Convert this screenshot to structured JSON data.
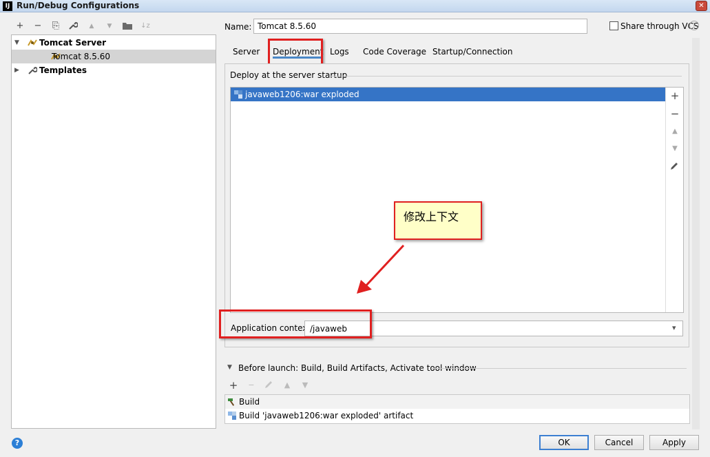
{
  "window": {
    "title": "Run/Debug Configurations",
    "icon_text": "IJ",
    "close_symbol": "✕"
  },
  "toolbar": {
    "icons": [
      {
        "name": "add-icon",
        "glyph": "+"
      },
      {
        "name": "remove-icon",
        "glyph": "−"
      },
      {
        "name": "copy-icon",
        "glyph": "⎘"
      },
      {
        "name": "wrench-icon",
        "glyph": "🔧"
      },
      {
        "name": "move-up-icon",
        "glyph": "▲"
      },
      {
        "name": "move-down-icon",
        "glyph": "▼"
      },
      {
        "name": "new-folder-icon",
        "glyph": "▰"
      },
      {
        "name": "sort-icon",
        "glyph": "↓z"
      }
    ]
  },
  "tree": {
    "group_label": "Tomcat Server",
    "config_label": "Tomcat 8.5.60",
    "templates_label": "Templates"
  },
  "config": {
    "name_label": "Name:",
    "name_value": "Tomcat 8.5.60",
    "share_label": "Share through VCS",
    "share_checked": false,
    "help_symbol": "?"
  },
  "tabs": [
    {
      "label": "Server",
      "active": false
    },
    {
      "label": "Deployment",
      "active": true
    },
    {
      "label": "Logs",
      "active": false
    },
    {
      "label": "Code Coverage",
      "active": false
    },
    {
      "label": "Startup/Connection",
      "active": false
    }
  ],
  "deployment": {
    "section_title": "Deploy at the server startup",
    "items": [
      "javaweb1206:war exploded"
    ],
    "context_label": "Application context:",
    "context_value": "/javaweb"
  },
  "annotation": {
    "callout_text": "修改上下文"
  },
  "before_launch": {
    "title": "Before launch: Build, Build Artifacts, Activate tool window",
    "items": [
      {
        "label": "Build",
        "icon": "hammer-icon"
      },
      {
        "label": "Build 'javaweb1206:war exploded' artifact",
        "icon": "artifact-icon"
      }
    ]
  },
  "buttons": {
    "help": "?",
    "ok": "OK",
    "cancel": "Cancel",
    "apply": "Apply"
  },
  "colors": {
    "selection": "#3574c6",
    "tab_underline": "#4a88c7",
    "annotation_red": "#e02020",
    "callout_bg": "#ffffc8"
  }
}
